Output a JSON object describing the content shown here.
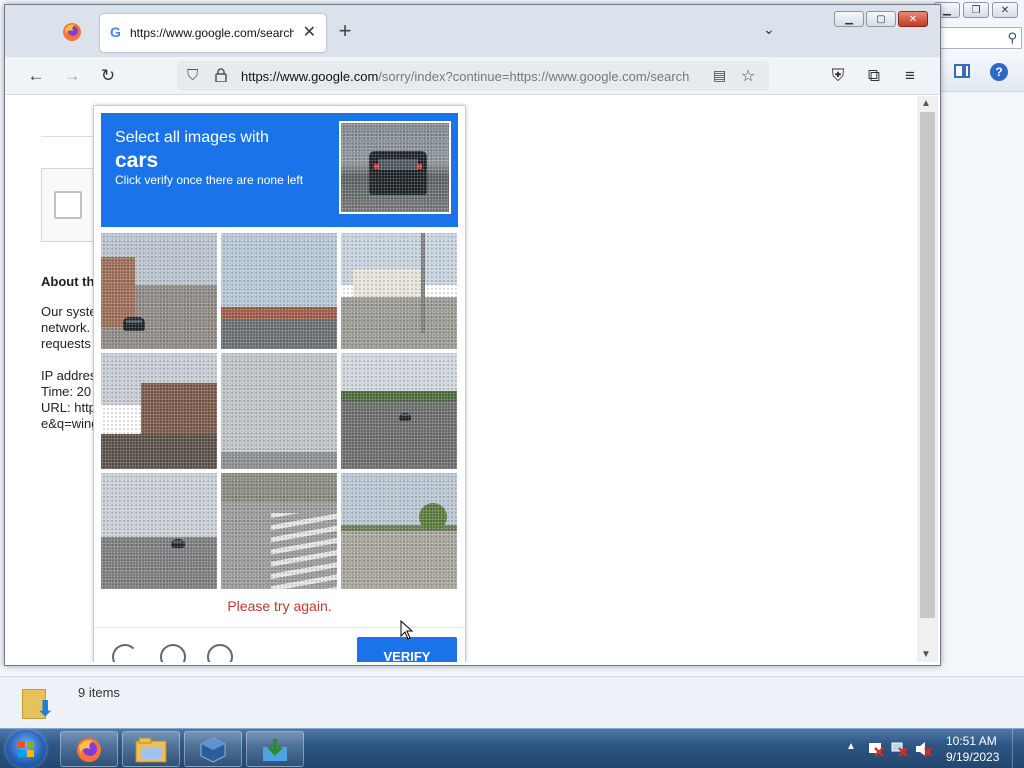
{
  "explorer": {
    "status_items": "9 items"
  },
  "browser": {
    "tab_title": "https://www.google.com/search",
    "url_host": "https://www.google.com",
    "url_rest": "/sorry/index?continue=https://www.google.com/search",
    "new_tab_icon": "plus-icon",
    "accent": "#1a73e8"
  },
  "page": {
    "about_heading": "About this page",
    "about_lines": [
      "Our systems have detected unusual traffic from your computer",
      "network.",
      "requests"
    ],
    "ip_line": "IP address",
    "time_line": "Time: 20",
    "url_line": "URL: http",
    "url_line2": "e&q=wing"
  },
  "captcha": {
    "prompt": "Select all images with",
    "target": "cars",
    "hint": "Click verify once there are none left",
    "error": "Please try again.",
    "verify_label": "VERIFY",
    "error_color": "#c0392b"
  },
  "taskbar": {
    "time": "10:51 AM",
    "date": "9/19/2023"
  }
}
